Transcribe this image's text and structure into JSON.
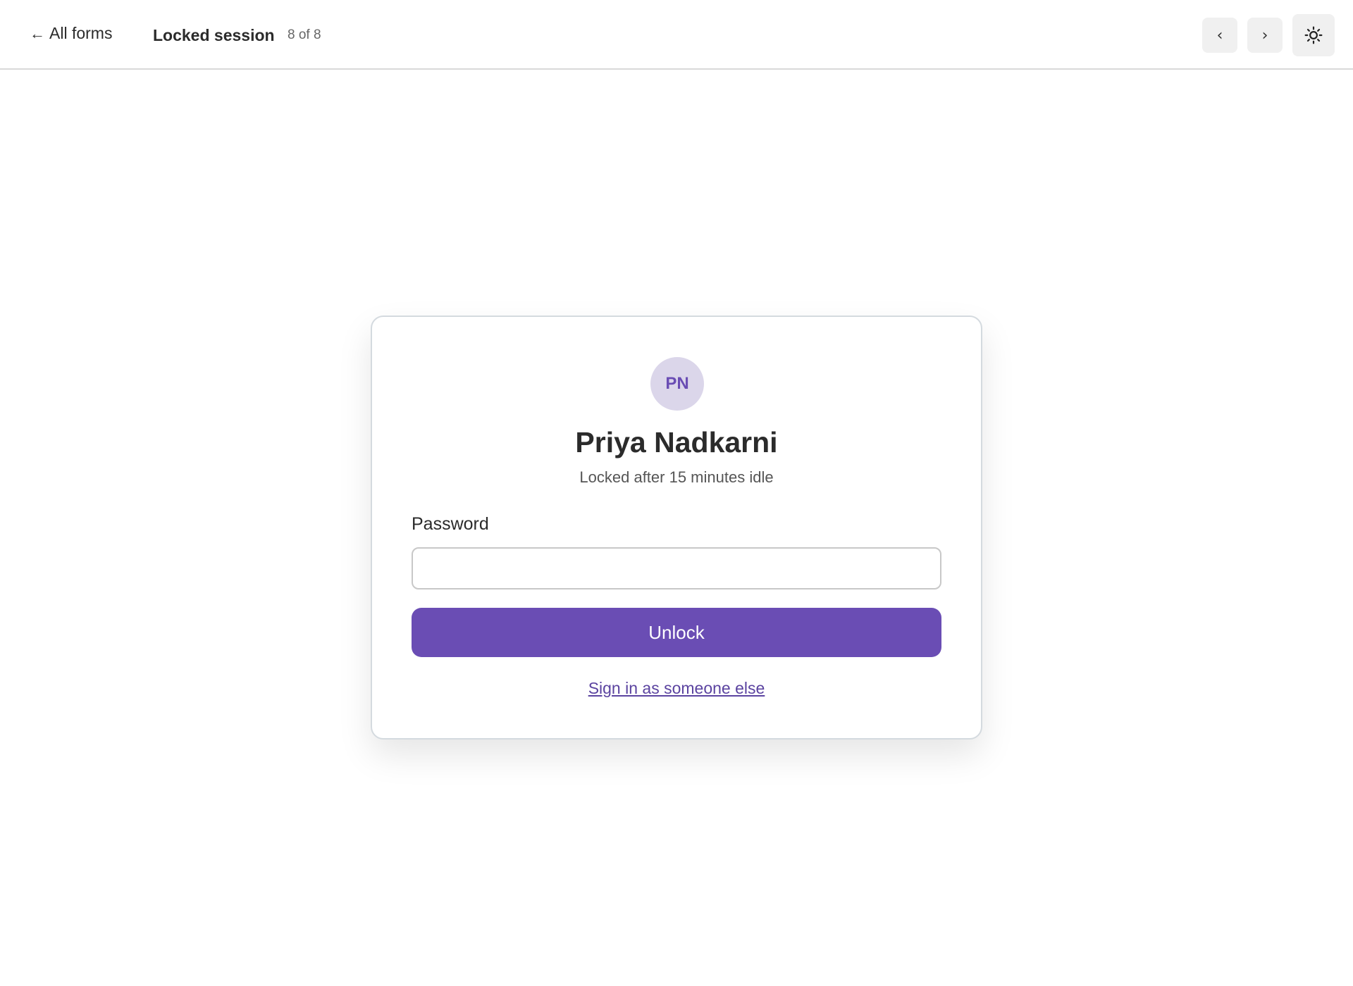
{
  "topbar": {
    "back_label": "All forms",
    "back_icon": "arrow-left-icon",
    "title": "Locked session",
    "counter": "8 of 8",
    "prev_glyph": "‹",
    "next_glyph": "›",
    "theme_icon": "sun-icon"
  },
  "card": {
    "avatar_initials": "PN",
    "user_name": "Priya Nadkarni",
    "lock_reason": "Locked after 15 minutes idle",
    "password_label": "Password",
    "password_value": "",
    "password_placeholder": "",
    "unlock_label": "Unlock",
    "switch_user_label": "Sign in as someone else"
  },
  "colors": {
    "accent": "#6a4db4",
    "avatar_bg": "#dbd6ea",
    "link": "#5b43a0"
  }
}
